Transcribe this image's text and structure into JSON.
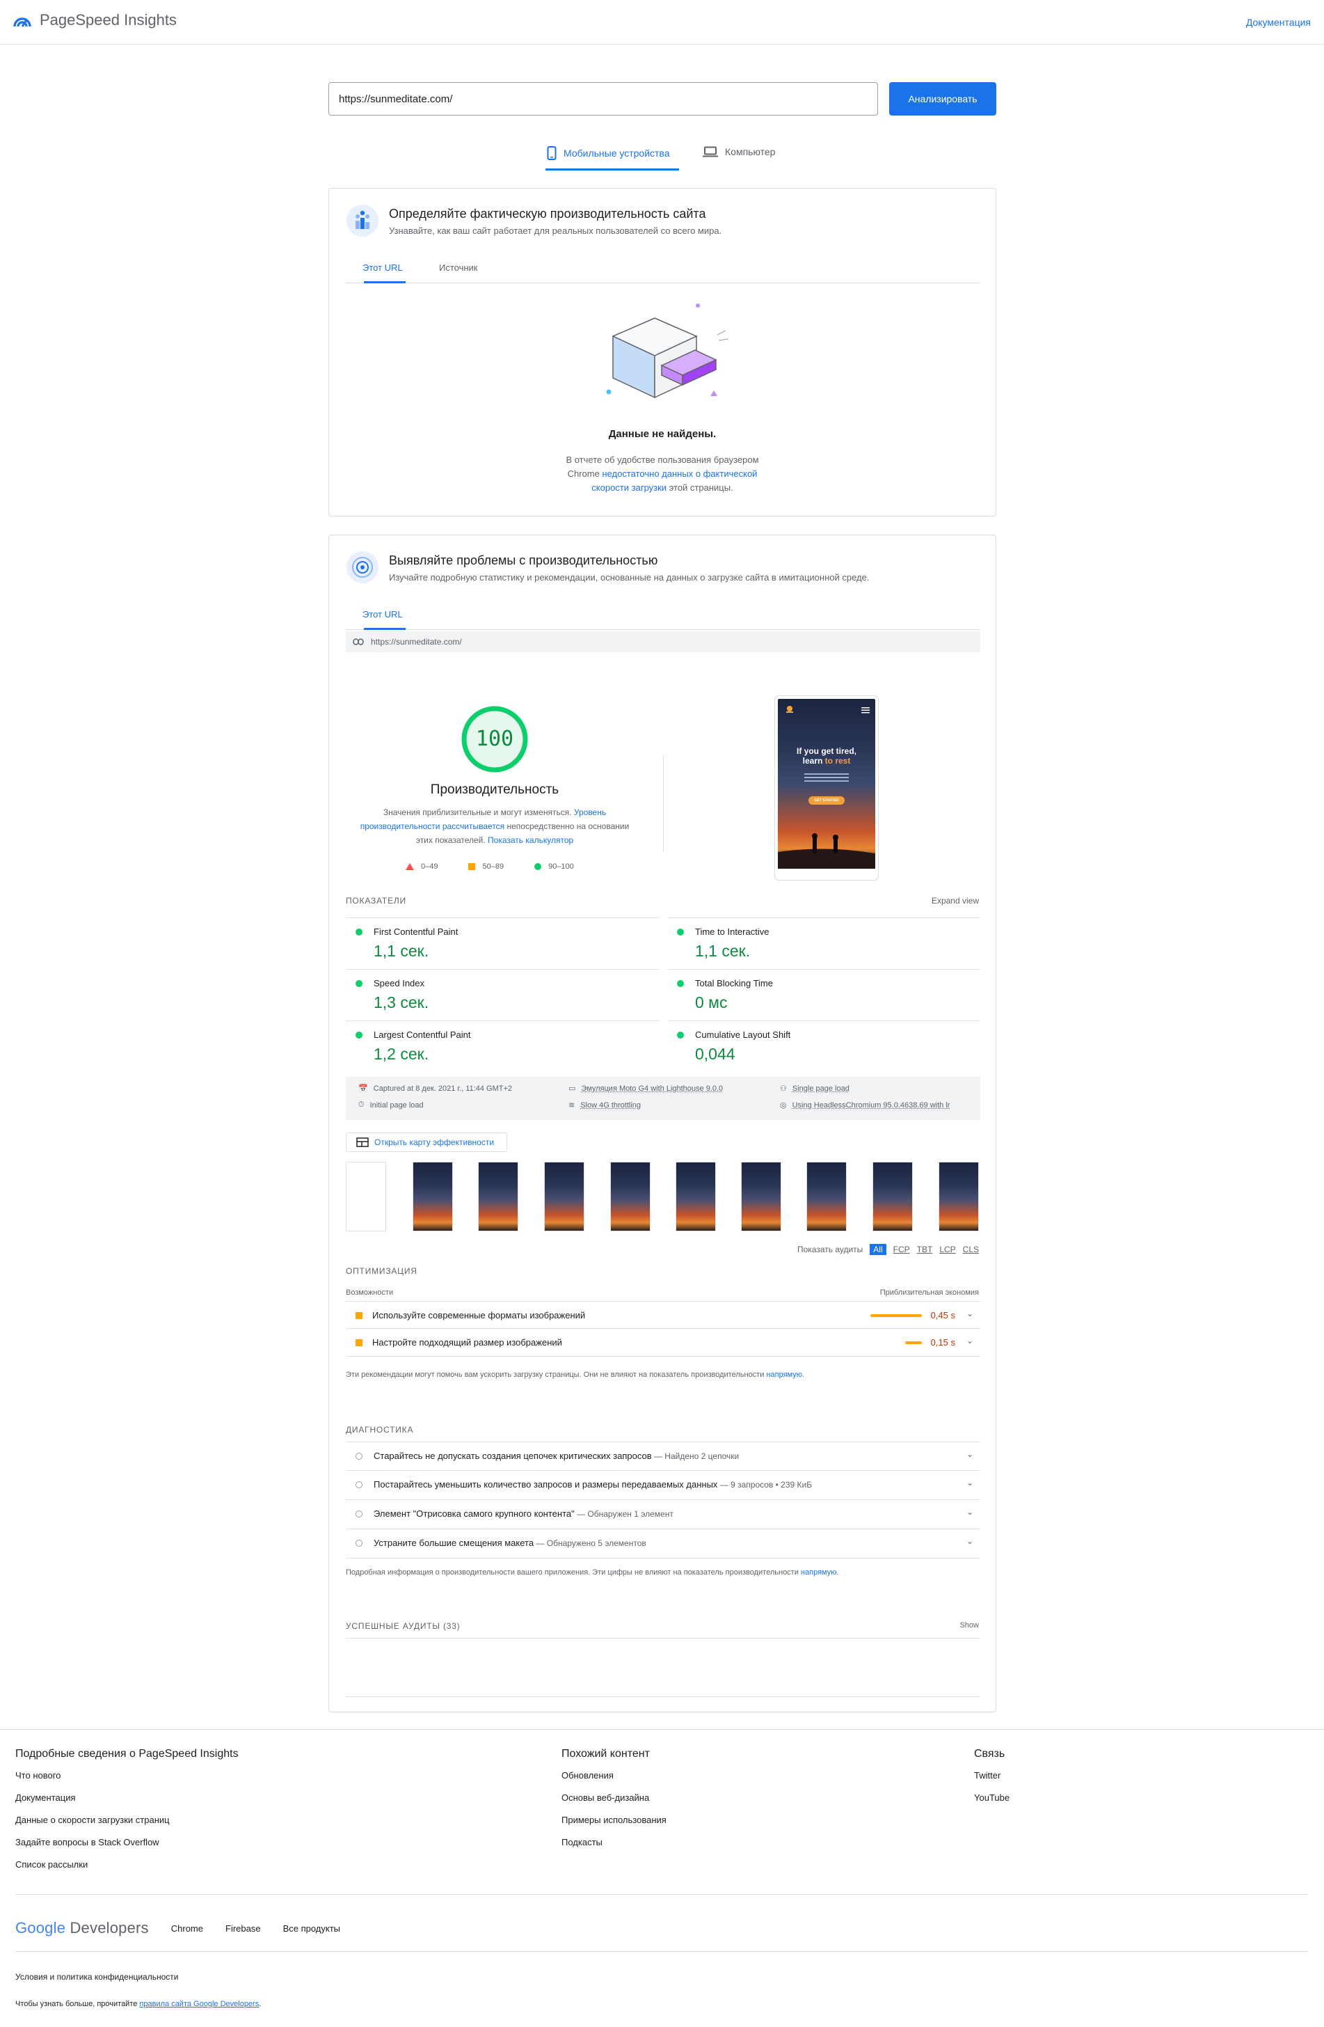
{
  "header": {
    "app_name": "PageSpeed Insights",
    "docs_link": "Документация"
  },
  "search": {
    "url": "https://sunmeditate.com/",
    "analyze_label": "Анализировать"
  },
  "device_tabs": {
    "mobile": "Мобильные устройства",
    "desktop": "Компьютер"
  },
  "field": {
    "title": "Определяйте фактическую производительность сайта",
    "subtitle": "Узнавайте, как ваш сайт работает для реальных пользователей со всего мира.",
    "tab_url": "Этот URL",
    "tab_origin": "Источник",
    "no_data_title": "Данные не найдены.",
    "no_data_line1": "В отчете об удобстве пользования браузером",
    "no_data_line2_pre": "Chrome ",
    "no_data_link1": "недостаточно данных о фактической",
    "no_data_link2": "скорости загрузки",
    "no_data_line3_post": " этой страницы."
  },
  "lab": {
    "title": "Выявляйте проблемы с производительностью",
    "subtitle": "Изучайте подробную статистику и рекомендации, основанные на данных о загрузке сайта в имитационной среде.",
    "tab_url": "Этот URL",
    "tested_url": "https://sunmeditate.com/",
    "score": "100",
    "score_value": 100,
    "score_label": "Производительность",
    "desc_pre": "Значения приблизительные и могут изменяться. ",
    "desc_link1": "Уровень",
    "desc_link2": "производительности рассчитывается",
    "desc_mid": " непосредственно на основании",
    "desc_line3": "этих показателей. ",
    "desc_link3": "Показать калькулятор",
    "legend": [
      "0–49",
      "50–89",
      "90–100"
    ],
    "phone": {
      "headline1": "If you get tired,",
      "headline2": "learn ",
      "headline_accent": "to rest",
      "cta": "GET STARTED"
    }
  },
  "metrics": {
    "label": "ПОКАЗАТЕЛИ",
    "expand": "Expand view",
    "items": [
      {
        "name": "First Contentful Paint",
        "value": "1,1 сек."
      },
      {
        "name": "Time to Interactive",
        "value": "1,1 сек."
      },
      {
        "name": "Speed Index",
        "value": "1,3 сек."
      },
      {
        "name": "Total Blocking Time",
        "value": "0 мс"
      },
      {
        "name": "Largest Contentful Paint",
        "value": "1,2 сек."
      },
      {
        "name": "Cumulative Layout Shift",
        "value": "0,044"
      }
    ]
  },
  "run_info": {
    "captured": "Captured at 8 дек. 2021 г., 11:44 GMT+2",
    "initial": "Initial page load",
    "emulation": "Эмуляция Moto G4 with Lighthouse 9.0.0",
    "throttling": "Slow 4G throttling",
    "single": "Single page load",
    "browser": "Using HeadlessChromium 95.0.4638.69 with lr"
  },
  "treemap_label": "Открыть карту эффективности",
  "audits_filter": {
    "label": "Показать аудиты",
    "items": [
      "All",
      "FCP",
      "TBT",
      "LCP",
      "CLS"
    ]
  },
  "optimization": {
    "label": "ОПТИМИЗАЦИЯ",
    "col_left": "Возможности",
    "col_right": "Приблизительная экономия",
    "items": [
      {
        "text": "Используйте современные форматы изображений",
        "value": "0,45 s",
        "bar_fraction": 1.0
      },
      {
        "text": "Настройте подходящий размер изображений",
        "value": "0,15 s",
        "bar_fraction": 0.33
      }
    ],
    "note_pre": "Эти рекомендации могут помочь вам ускорить загрузку страницы. Они не влияют на показатель производительности ",
    "note_link": "напрямую",
    "note_post": "."
  },
  "diagnostics": {
    "label": "ДИАГНОСТИКА",
    "items": [
      {
        "text": "Старайтесь не допускать создания цепочек критических запросов",
        "detail": " — Найдено 2 цепочки"
      },
      {
        "text": "Постарайтесь уменьшить количество запросов и размеры передаваемых данных",
        "detail": " — 9 запросов • 239 КиБ"
      },
      {
        "text": "Элемент \"Отрисовка самого крупного контента\"",
        "detail": " — Обнаружен 1 элемент"
      },
      {
        "text": "Устраните большие смещения макета",
        "detail": " — Обнаружено 5 элементов"
      }
    ],
    "note_pre": "Подробная информация о производительности вашего приложения. Эти цифры не влияют на показатель производительности ",
    "note_link": "напрямую",
    "note_post": "."
  },
  "passed": {
    "label": "УСПЕШНЫЕ АУДИТЫ (33)",
    "show": "Show"
  },
  "footer": {
    "col1": {
      "title": "Подробные сведения о PageSpeed Insights",
      "links": [
        "Что нового",
        "Документация",
        "Данные о скорости загрузки страниц",
        "Задайте вопросы в Stack Overflow",
        "Список рассылки"
      ]
    },
    "col2": {
      "title": "Похожий контент",
      "links": [
        "Обновления",
        "Основы веб-дизайна",
        "Примеры использования",
        "Подкасты"
      ]
    },
    "col3": {
      "title": "Связь",
      "links": [
        "Twitter",
        "YouTube"
      ]
    },
    "brand_google": "Google",
    "brand_dev": "Developers",
    "products": [
      "Chrome",
      "Firebase",
      "Все продукты"
    ],
    "terms": "Условия и политика конфиденциальности",
    "more_pre": "Чтобы узнать больше, прочитайте ",
    "more_link": "правила сайта Google Developers",
    "more_post": "."
  },
  "colors": {
    "accent": "#1a73e8",
    "pass": "#0cce6b",
    "pass_text": "#0d8a3d",
    "average": "#ffa400",
    "fail": "#ff4e42"
  }
}
